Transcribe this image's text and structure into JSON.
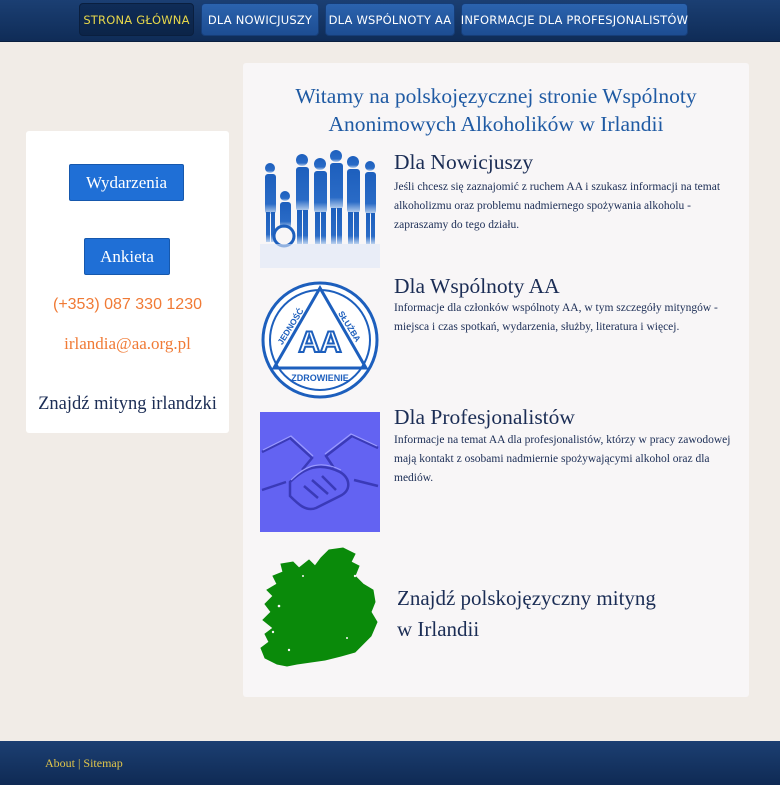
{
  "nav": {
    "items": [
      {
        "label": "STRONA GŁÓWNA",
        "active": true
      },
      {
        "label": "DLA NOWICJUSZY",
        "active": false
      },
      {
        "label": "DLA WSPÓLNOTY AA",
        "active": false
      },
      {
        "label": "INFORMACJE DLA PROFESJONALISTÓW",
        "active": false
      }
    ]
  },
  "sidebar": {
    "events_button": "Wydarzenia",
    "survey_button": "Ankieta",
    "phone": "(+353) 087 330 1230",
    "email": "irlandia@aa.org.pl",
    "find_irish_meeting": "Znajdź mityng irlandzki"
  },
  "main": {
    "welcome": "Witamy na polskojęzycznej stronie Wspólnoty Anonimowych Alkoholików w Irlandii",
    "sections": [
      {
        "title": "Dla Nowicjuszy",
        "text": "Jeśli chcesz się zaznajomić z ruchem AA i szukasz informacji na temat alkoholizmu oraz problemu nadmiernego spożywania alkoholu - zapraszamy do tego działu.",
        "icon": "people-silhouettes-icon"
      },
      {
        "title": "Dla Wspólnoty AA",
        "text": "Informacje dla członków wspólnoty AA, w tym szczegóły mityngów - miejsca i czas spotkań, wydarzenia, służby, literatura i więcej.",
        "icon": "aa-logo-icon"
      },
      {
        "title": "Dla Profesjonalistów",
        "text": "Informacje na temat AA dla profesjonalistów, którzy w pracy zawodowej mają kontakt z osobami nadmiernie spożywającymi alkohol oraz dla mediów.",
        "icon": "handshake-icon"
      }
    ],
    "find_polish_line1": "Znajdź polskojęzyczny mityng",
    "find_polish_line2": "w Irlandii"
  },
  "logo": {
    "top_left": "JEDNOŚĆ",
    "top_right": "SŁUŻBA",
    "center": "AA",
    "bottom": "ZDROWIENIE"
  },
  "footer": {
    "about": "About",
    "separator": "|",
    "sitemap": "Sitemap"
  },
  "colors": {
    "nav_bg": "#0f2c57",
    "nav_button": "#2b63ae",
    "active_text": "#e7d74a",
    "accent_orange": "#f07a35",
    "ireland_green": "#0a8a0a"
  }
}
